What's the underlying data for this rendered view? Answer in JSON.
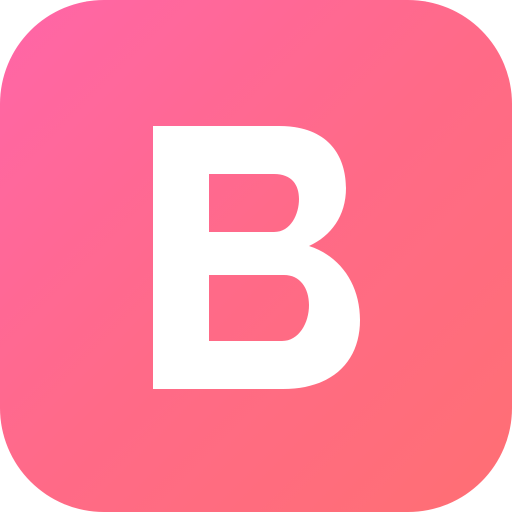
{
  "app_icon": {
    "logo_letter": "B",
    "background_gradient": [
      "#ff66a8",
      "#ff6a88",
      "#ff6f73"
    ],
    "glyph_color": "#ffffff"
  }
}
